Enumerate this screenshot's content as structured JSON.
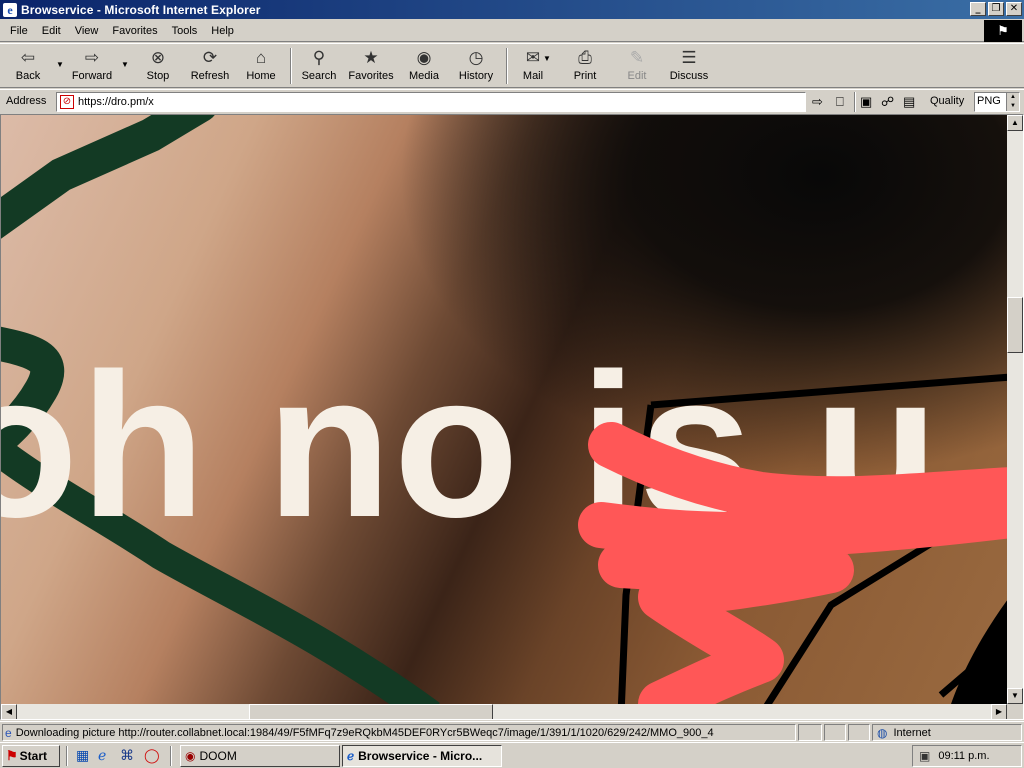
{
  "window": {
    "title": "Browservice - Microsoft Internet Explorer",
    "controls": [
      "_",
      "❐",
      "✕"
    ]
  },
  "menu": {
    "items": [
      "File",
      "Edit",
      "View",
      "Favorites",
      "Tools",
      "Help"
    ]
  },
  "toolbar": {
    "back": "Back",
    "forward": "Forward",
    "stop": "Stop",
    "refresh": "Refresh",
    "home": "Home",
    "search": "Search",
    "favorites": "Favorites",
    "media": "Media",
    "history": "History",
    "mail": "Mail",
    "print": "Print",
    "edit": "Edit",
    "discuss": "Discuss"
  },
  "address": {
    "label": "Address",
    "url": "https://dro.pm/x",
    "quality_label": "Quality",
    "quality_value": "PNG"
  },
  "page": {
    "hero_text": "oh no is u",
    "colors": {
      "text": "#f6efe5",
      "red_stroke": "#ff5757",
      "green_stroke": "#133a24",
      "black_stroke": "#000000"
    }
  },
  "status": {
    "text": "Downloading picture http://router.collabnet.local:1984/49/F5fMFq7z9eRQkbM45DEF0RYcr5BWeqc7/image/1/391/1/1020/629/242/MMO_900_4",
    "zone": "Internet"
  },
  "taskbar": {
    "start": "Start",
    "tasks": [
      {
        "label": "DOOM",
        "active": false
      },
      {
        "label": "Browservice - Micro...",
        "active": true
      }
    ],
    "clock": "09:11 p.m."
  }
}
